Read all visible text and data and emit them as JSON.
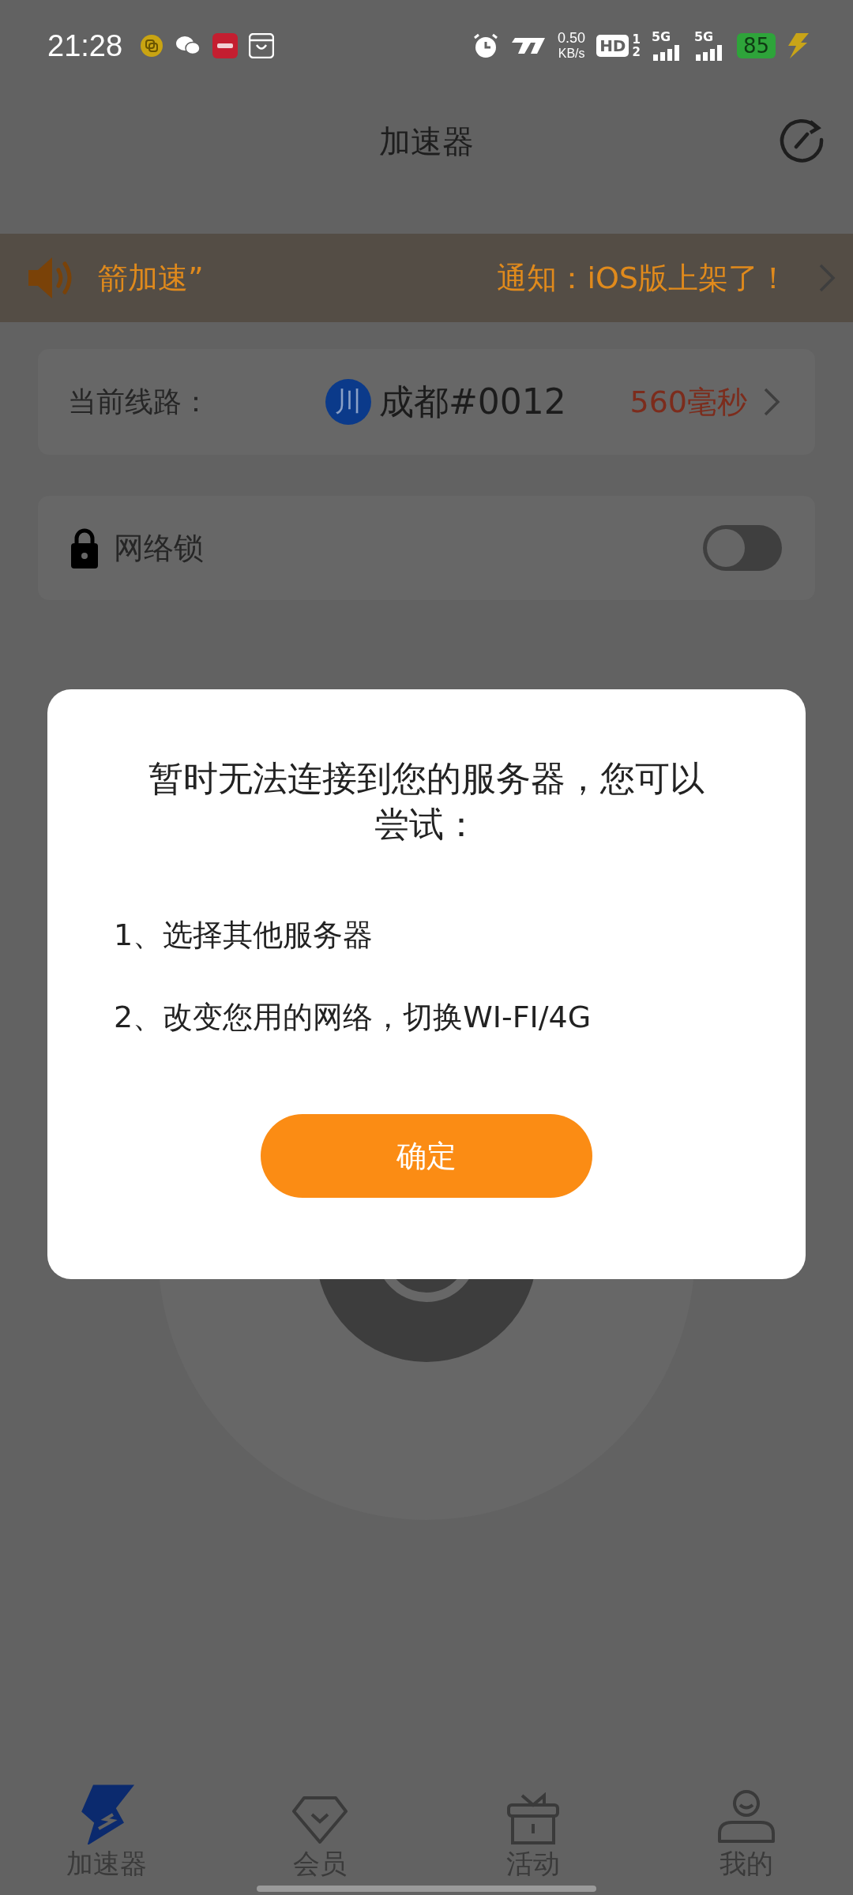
{
  "status_bar": {
    "time": "21:28",
    "net_speed": "0.50",
    "net_unit": "KB/s",
    "hd": "HD",
    "hd_sims": [
      "1",
      "2"
    ],
    "signals": [
      "5G",
      "5G"
    ],
    "battery": "85"
  },
  "header": {
    "title": "加速器"
  },
  "notice": {
    "marquee": "箭加速”",
    "text": "通知：iOS版上架了！"
  },
  "route": {
    "label": "当前线路：",
    "region_badge": "川",
    "server": "成都#0012",
    "latency": "560毫秒"
  },
  "lock": {
    "label": "网络锁",
    "on": false
  },
  "dialog": {
    "message": "暂时无法连接到您的服务器，您可以尝试：",
    "items": [
      "1、选择其他服务器",
      "2、改变您用的网络，切换WI-FI/4G"
    ],
    "button": "确定"
  },
  "tabs": [
    {
      "label": "加速器",
      "kind": "bolt",
      "selected": true
    },
    {
      "label": "会员",
      "kind": "gem",
      "selected": false
    },
    {
      "label": "活动",
      "kind": "gift",
      "selected": false
    },
    {
      "label": "我的",
      "kind": "user",
      "selected": false
    }
  ]
}
